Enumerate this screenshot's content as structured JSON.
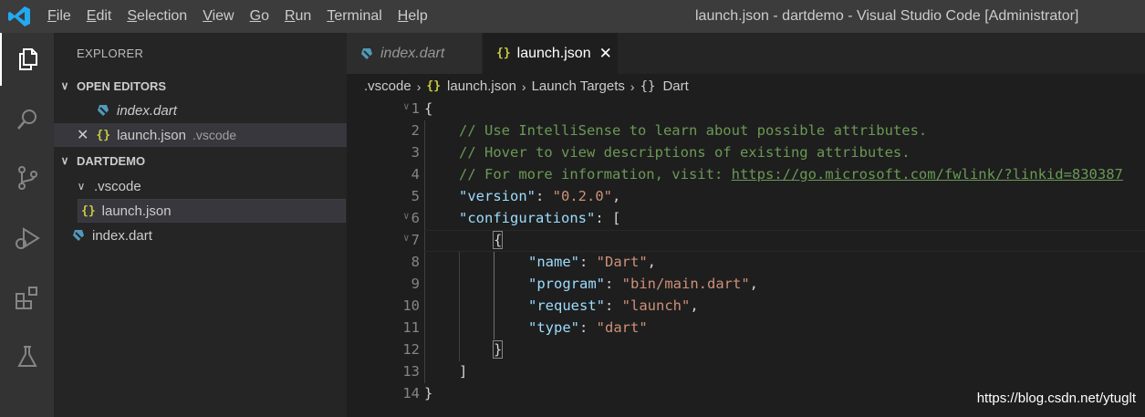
{
  "titlebar": {
    "menu": [
      "File",
      "Edit",
      "Selection",
      "View",
      "Go",
      "Run",
      "Terminal",
      "Help"
    ],
    "window_title": "launch.json - dartdemo - Visual Studio Code [Administrator]"
  },
  "activity_bar": {
    "icons": [
      "explorer-icon",
      "search-icon",
      "source-control-icon",
      "run-debug-icon",
      "extensions-icon",
      "testing-icon"
    ]
  },
  "sidebar": {
    "header": "EXPLORER",
    "open_editors_label": "OPEN EDITORS",
    "open_editors": [
      {
        "name": "index.dart"
      },
      {
        "name": "launch.json",
        "folder": ".vscode"
      }
    ],
    "project_label": "DARTDEMO",
    "tree": [
      {
        "name": ".vscode"
      },
      {
        "name": "launch.json"
      },
      {
        "name": "index.dart"
      }
    ]
  },
  "tabs": [
    {
      "label": "index.dart"
    },
    {
      "label": "launch.json"
    }
  ],
  "breadcrumb": [
    ".vscode",
    "launch.json",
    "Launch Targets",
    "Dart"
  ],
  "code": {
    "line_numbers": [
      "1",
      "2",
      "3",
      "4",
      "5",
      "6",
      "7",
      "8",
      "9",
      "10",
      "11",
      "12",
      "13",
      "14"
    ],
    "l1": "{",
    "l2": "// Use IntelliSense to learn about possible attributes.",
    "l3": "// Hover to view descriptions of existing attributes.",
    "l4_prefix": "// For more information, visit: ",
    "l4_link": "https://go.microsoft.com/fwlink/?linkid=830387",
    "l5_key": "\"version\"",
    "l5_val": "\"0.2.0\"",
    "l6_key": "\"configurations\"",
    "l6_rest": ": [",
    "l7": "{",
    "l8_key": "\"name\"",
    "l8_val": "\"Dart\"",
    "l9_key": "\"program\"",
    "l9_val": "\"bin/main.dart\"",
    "l10_key": "\"request\"",
    "l10_val": "\"launch\"",
    "l11_key": "\"type\"",
    "l11_val": "\"dart\"",
    "l12": "}",
    "l13": "]",
    "l14": "}"
  },
  "watermark": "https://blog.csdn.net/ytuglt",
  "colors": {
    "accent_logo": "#23a9f2",
    "json_icon": "#cbcb41",
    "dart_icon": "#519aba",
    "comment": "#6a9955",
    "key": "#9cdcfe",
    "string": "#ce9178"
  }
}
